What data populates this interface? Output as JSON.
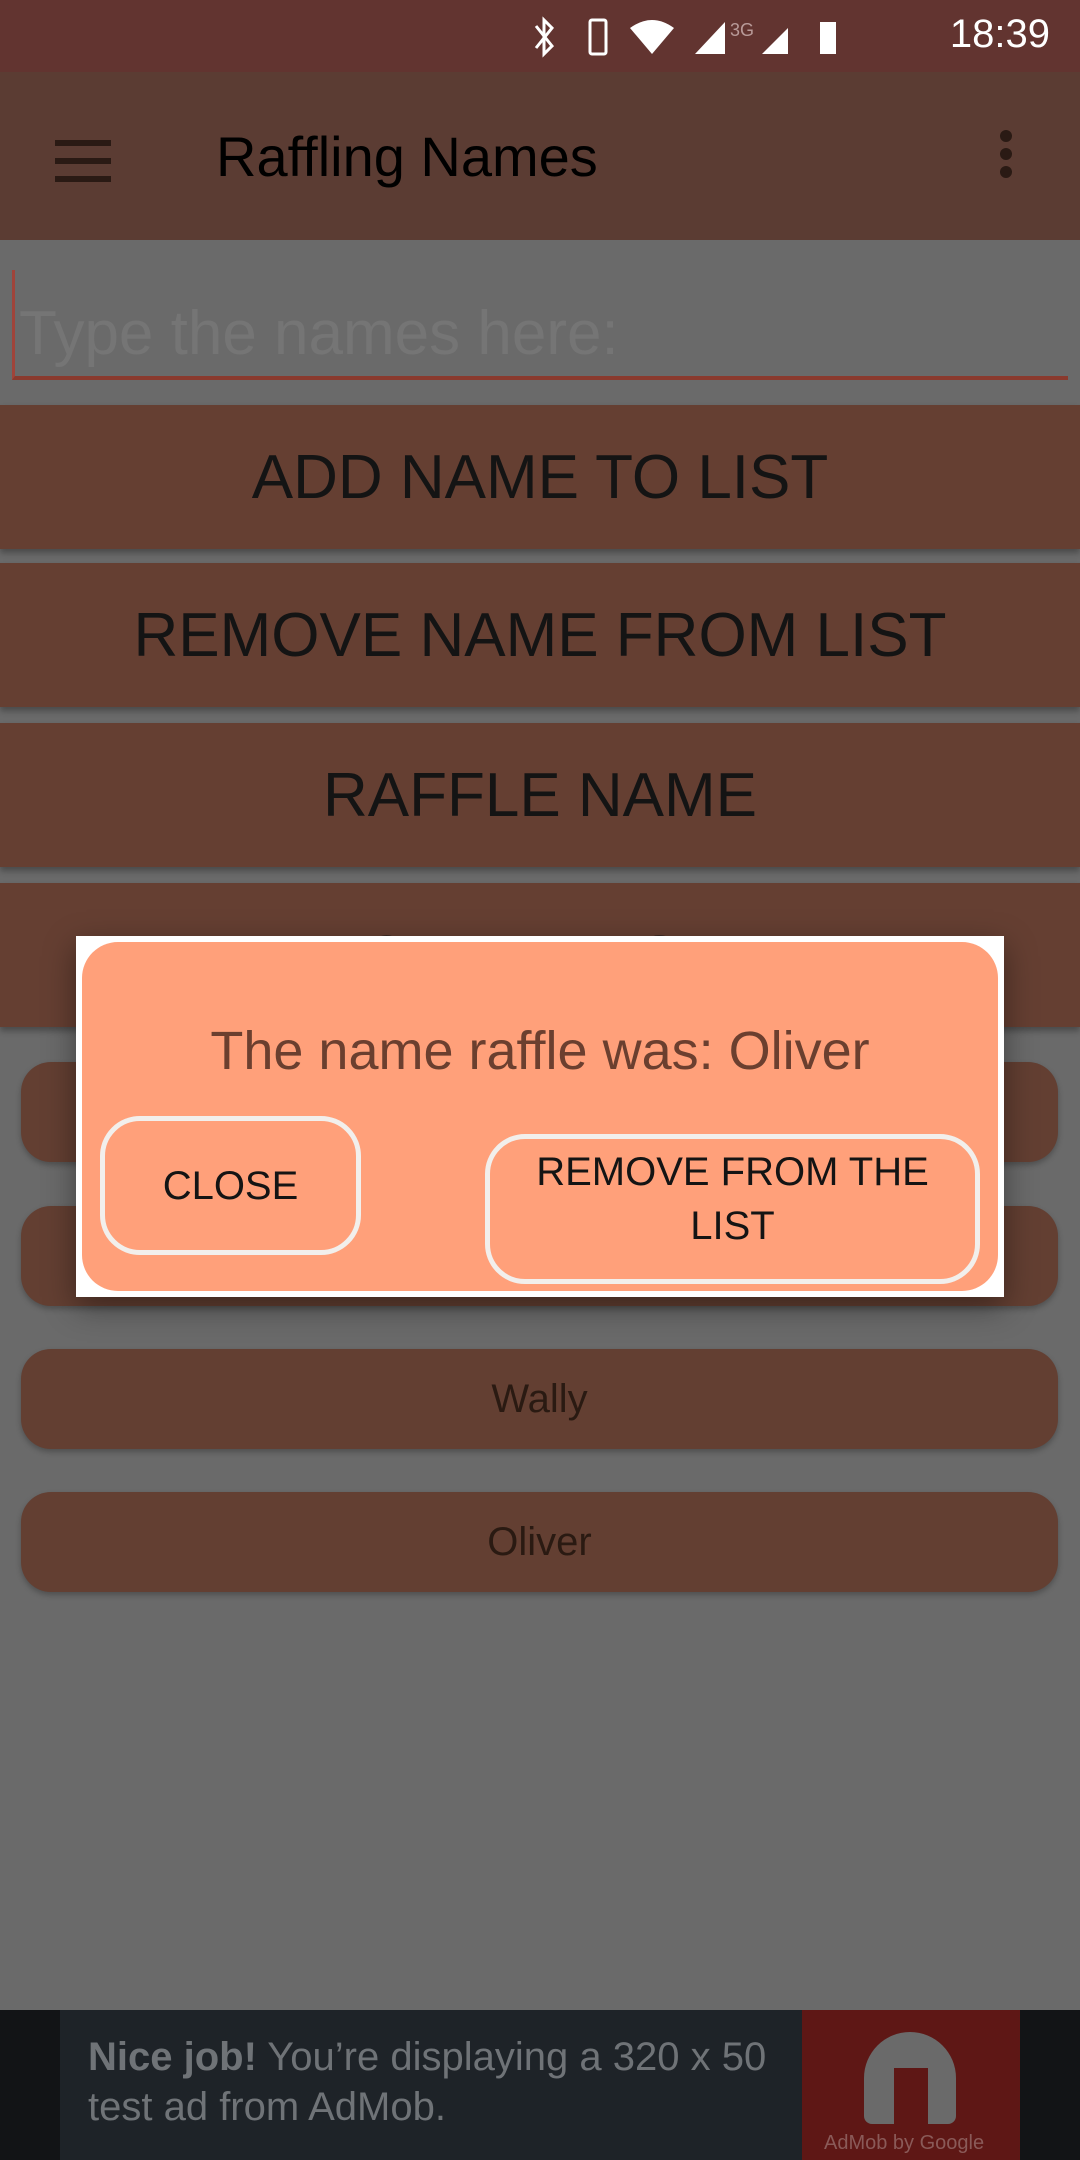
{
  "status_bar": {
    "time": "18:39",
    "network": "3G",
    "icons": [
      "bluetooth-icon",
      "vibrate-icon",
      "wifi-icon",
      "signal-icon",
      "battery-icon"
    ]
  },
  "app_bar": {
    "title": "Raffling Names"
  },
  "input": {
    "placeholder": "Type the names here:",
    "value": ""
  },
  "buttons": {
    "add": "ADD NAME TO LIST",
    "remove": "REMOVE NAME FROM LIST",
    "raffle": "RAFFLE NAME",
    "clear": "CLEAR LIST"
  },
  "list": [
    {
      "name": ""
    },
    {
      "name": ""
    },
    {
      "name": "Wally"
    },
    {
      "name": "Oliver"
    }
  ],
  "dialog": {
    "message": "The name raffle was: Oliver",
    "close": "CLOSE",
    "remove": "REMOVE FROM THE LIST"
  },
  "ad": {
    "bold": "Nice job!",
    "text": " You’re displaying a 320 x 50 test ad from AdMob.",
    "brand": "AdMob by Google"
  },
  "colors": {
    "status_bar": "#623430",
    "app_bar": "#5b3c33",
    "button": "#653f32",
    "dialog": "#ffa07a"
  }
}
